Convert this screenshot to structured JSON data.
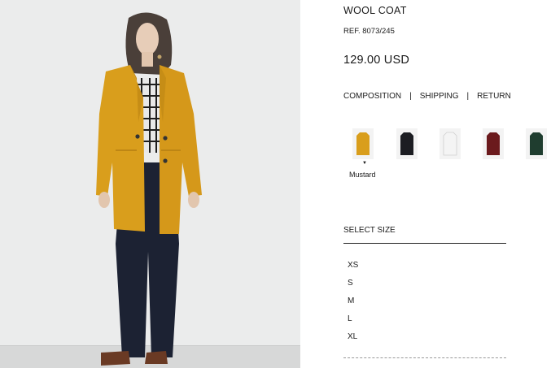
{
  "product": {
    "title": "WOOL COAT",
    "ref": "REF. 8073/245",
    "price": "129.00 USD"
  },
  "info_links": [
    "COMPOSITION",
    "|",
    "SHIPPING",
    "|",
    "RETURN"
  ],
  "colors": [
    {
      "name": "Mustard",
      "hex": "#d99e1c",
      "selected": true
    },
    {
      "name": "Black",
      "hex": "#1c1d22",
      "selected": false
    },
    {
      "name": "White",
      "hex": "#f4f4f4",
      "selected": false
    },
    {
      "name": "Burgundy",
      "hex": "#6b1a1d",
      "selected": false
    },
    {
      "name": "Green",
      "hex": "#1f3d2f",
      "selected": false
    }
  ],
  "selected_color_label": "Mustard",
  "size_section": {
    "header": "SELECT SIZE",
    "options": [
      "XS",
      "S",
      "M",
      "L",
      "XL"
    ]
  }
}
